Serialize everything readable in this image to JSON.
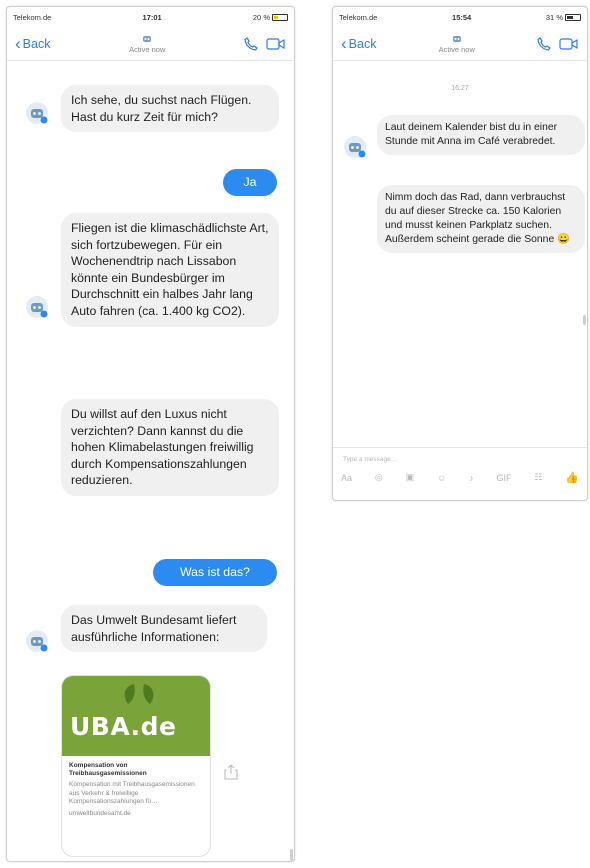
{
  "left_phone": {
    "status": {
      "carrier": "Telekom.de",
      "time": "17:01",
      "battery": "20 %"
    },
    "nav": {
      "back_label": "Back",
      "subtitle": "Active now"
    },
    "messages": [
      {
        "from": "bot",
        "text": "Ich sehe, du suchst nach Flügen. Hast du kurz Zeit für mich?"
      },
      {
        "from": "user",
        "text": "Ja"
      },
      {
        "from": "bot",
        "text": "Fliegen ist die klimaschädlichste Art, sich fortzubewegen. Für ein Wochenendtrip nach Lissabon könnte ein Bundesbürger im Durchschnitt ein halbes Jahr lang Auto fahren (ca. 1.400 kg CO2)."
      },
      {
        "from": "bot",
        "text": "Du willst auf den Luxus nicht verzichten? Dann kannst du die hohen Klimabelastungen freiwillig durch Kompensationszahlungen reduzieren."
      },
      {
        "from": "user",
        "text": "Was ist das?"
      },
      {
        "from": "bot",
        "text": "Das Umwelt Bundesamt liefert ausführliche Informationen:"
      }
    ],
    "link_card": {
      "logo_text": "UBA.de",
      "title": "Kompensation von Treibhausgasemissionen",
      "description": "Kompensation mit Treibhausgasemissionen aus Verkehr & freiwillige Kompensationszahlungen fü…",
      "url": "umweltbundesamt.de"
    }
  },
  "right_phone": {
    "status": {
      "carrier": "Telekom.de",
      "time": "15:54",
      "battery": "31 %"
    },
    "nav": {
      "back_label": "Back",
      "subtitle": "Active now"
    },
    "timestamp": "16:27",
    "messages": [
      {
        "from": "bot",
        "text": "Laut deinem Kalender bist du in einer Stunde mit Anna im Café verabredet."
      },
      {
        "from": "bot",
        "text": "Nimm doch das Rad, dann verbrauchst du auf dieser Strecke ca. 150 Kalorien und musst keinen Parkplatz suchen. Außerdem scheint gerade die Sonne 😀"
      }
    ],
    "composer": {
      "placeholder": "Type a message…",
      "tools": [
        "Aa",
        "◎",
        "▣",
        "☺",
        "♪",
        "GIF",
        "☷",
        "👍"
      ]
    }
  },
  "colors": {
    "accent": "#2b8bf0",
    "bubble_in": "#f0f0f0",
    "uba_green": "#7aa33a"
  }
}
